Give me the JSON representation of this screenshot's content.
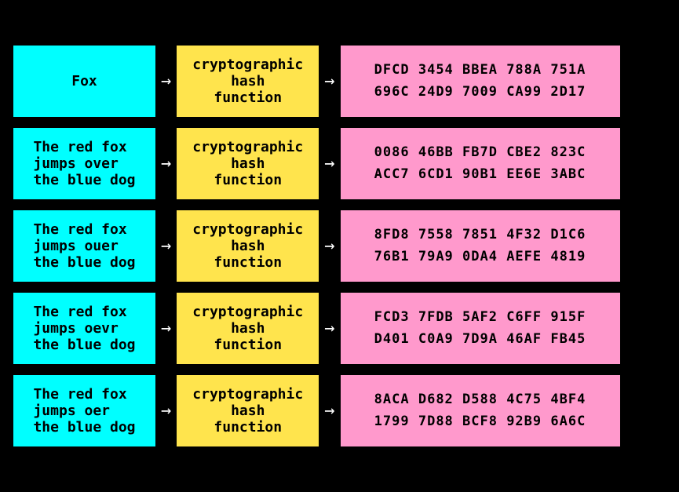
{
  "rows": [
    {
      "input": "Fox",
      "hash_label": "cryptographic\nhash\nfunction",
      "output_line1": "DFCD  3454  BBEA  788A  751A",
      "output_line2": "696C  24D9  7009  CA99  2D17"
    },
    {
      "input": "The red fox\njumps over\nthe blue dog",
      "hash_label": "cryptographic\nhash\nfunction",
      "output_line1": "0086  46BB  FB7D  CBE2  823C",
      "output_line2": "ACC7  6CD1  90B1  EE6E  3ABC"
    },
    {
      "input": "The red fox\njumps ouer\nthe blue dog",
      "hash_label": "cryptographic\nhash\nfunction",
      "output_line1": "8FD8  7558  7851  4F32  D1C6",
      "output_line2": "76B1  79A9  0DA4  AEFE  4819"
    },
    {
      "input": "The red fox\njumps oevr\nthe blue dog",
      "hash_label": "cryptographic\nhash\nfunction",
      "output_line1": "FCD3  7FDB  5AF2  C6FF  915F",
      "output_line2": "D401  C0A9  7D9A  46AF  FB45"
    },
    {
      "input": "The red fox\njumps oer\nthe blue dog",
      "hash_label": "cryptographic\nhash\nfunction",
      "output_line1": "8ACA  D682  D588  4C75  4BF4",
      "output_line2": "1799  7D88  BCF8  92B9  6A6C"
    }
  ],
  "arrows": {
    "right": "→"
  }
}
